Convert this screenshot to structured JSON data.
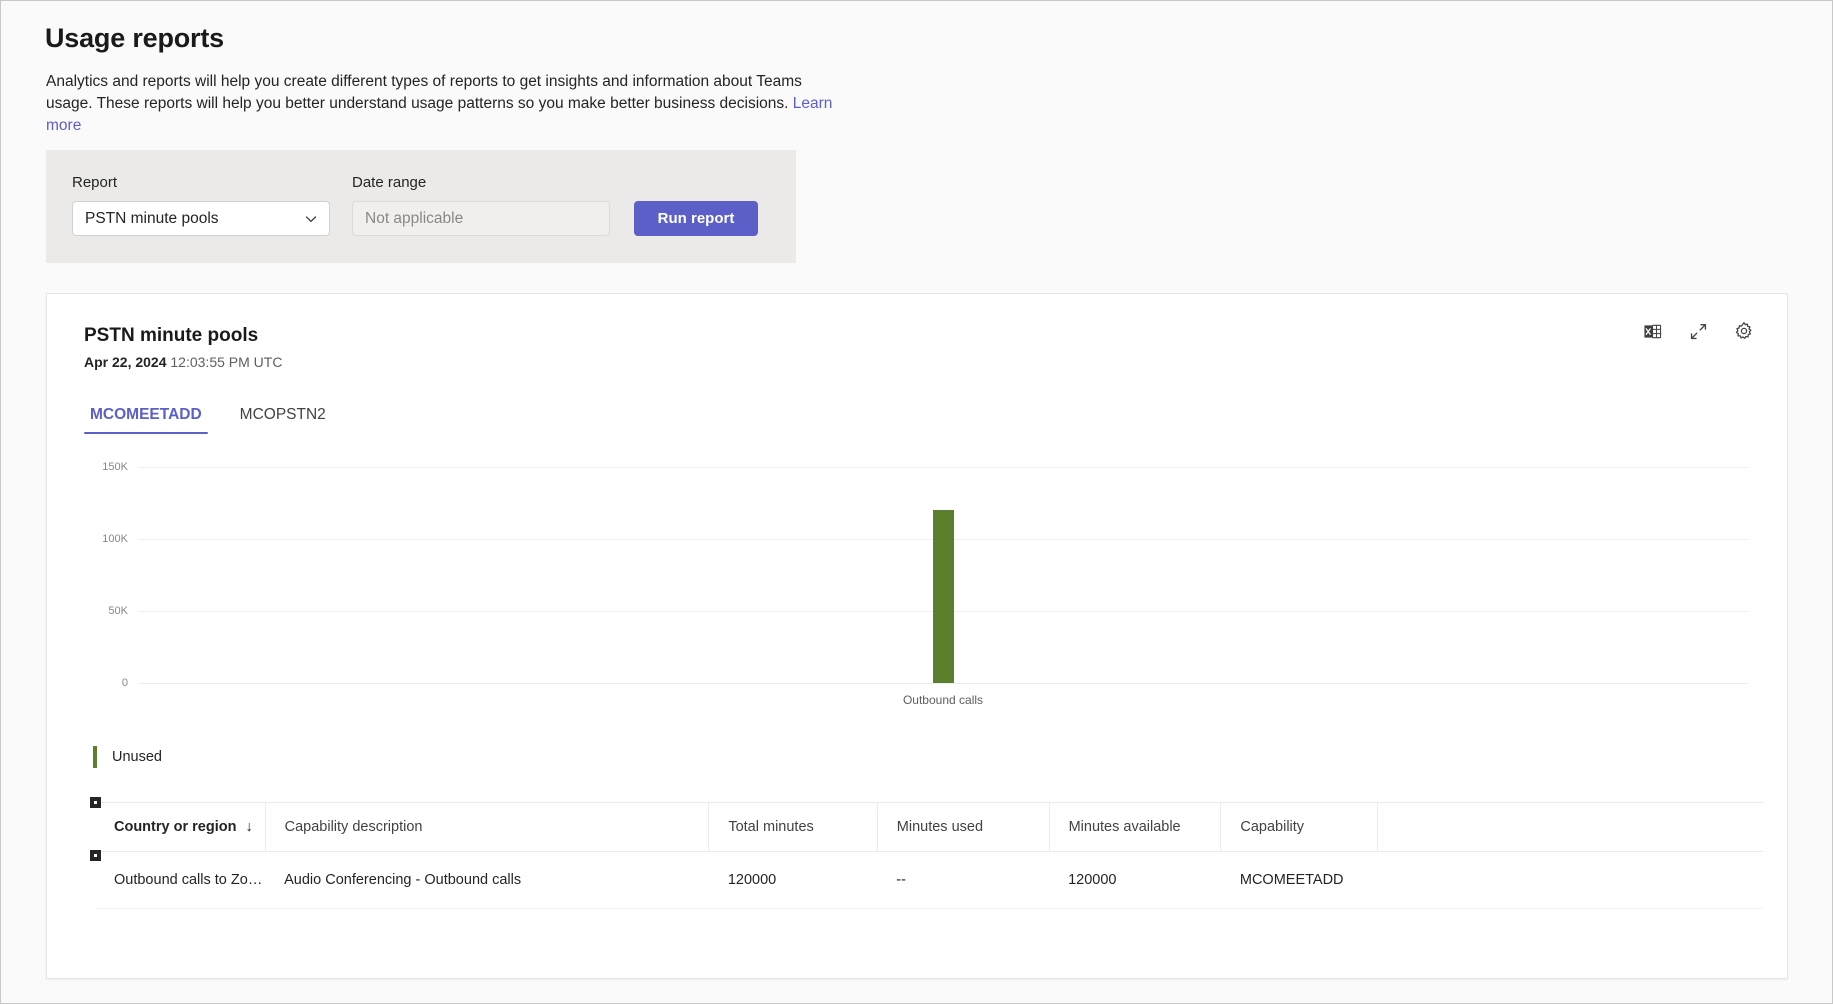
{
  "page": {
    "title": "Usage reports",
    "description_line1": "Analytics and reports will help you create different types of reports to get insights and information about Teams usage. These",
    "description_line2": "reports will help you better understand usage patterns so you make better business decisions.",
    "learn_more": "Learn more"
  },
  "filters": {
    "report_label": "Report",
    "report_value": "PSTN minute pools",
    "date_range_label": "Date range",
    "date_range_placeholder": "Not applicable",
    "run_report_label": "Run report"
  },
  "card": {
    "title": "PSTN minute pools",
    "date": "Apr 22, 2024",
    "time": "12:03:55 PM UTC",
    "actions": [
      {
        "name": "export-excel-icon",
        "tooltip": "Export to Excel"
      },
      {
        "name": "fullscreen-icon",
        "tooltip": "Full screen"
      },
      {
        "name": "gear-icon",
        "tooltip": "Settings"
      }
    ],
    "tabs": [
      {
        "label": "MCOMEETADD",
        "active": true
      },
      {
        "label": "MCOPSTN2",
        "active": false
      }
    ]
  },
  "chart_data": {
    "type": "bar",
    "title": "",
    "categories": [
      "Outbound calls"
    ],
    "series": [
      {
        "name": "Unused",
        "values": [
          120000
        ],
        "color": "#5d7e2d"
      }
    ],
    "yticks": [
      0,
      50000,
      100000,
      150000
    ],
    "ytick_labels": [
      "0",
      "50K",
      "100K",
      "150K"
    ],
    "ylim": [
      0,
      150000
    ],
    "xlabel": "",
    "ylabel": "",
    "grid": true,
    "legend": [
      {
        "label": "Unused",
        "color": "#5d7e2d"
      }
    ],
    "legend_position": "bottom-left"
  },
  "table": {
    "columns": [
      {
        "label": "Country or region",
        "sorted": true,
        "sort_dir": "↓"
      },
      {
        "label": "Capability description",
        "sorted": false
      },
      {
        "label": "Total minutes",
        "sorted": false
      },
      {
        "label": "Minutes used",
        "sorted": false
      },
      {
        "label": "Minutes available",
        "sorted": false
      },
      {
        "label": "Capability",
        "sorted": false
      },
      {
        "label": "",
        "sorted": false
      }
    ],
    "rows": [
      {
        "country": "Outbound calls to Zone ...",
        "capability_description": "Audio Conferencing - Outbound calls",
        "total_minutes": "120000",
        "minutes_used": "--",
        "minutes_available": "120000",
        "capability": "MCOMEETADD",
        "extra": ""
      }
    ]
  },
  "colors": {
    "accent": "#5b5fc7",
    "bar_green": "#5d7e2d",
    "panel_bg": "#ebeae9"
  }
}
